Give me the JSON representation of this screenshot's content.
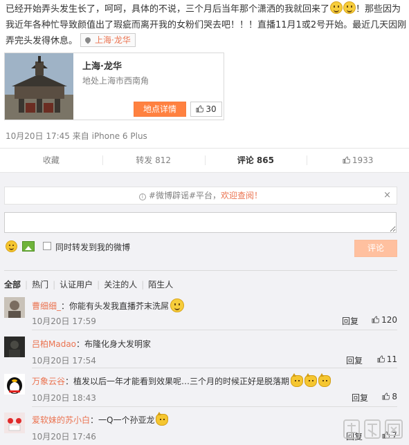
{
  "post": {
    "text_part1": "已经开始弄头发生长了，呵呵，具体的不说，三个月后当年那个潇洒的我就回来了",
    "text_part2": "！那些因为我近年各种忙导致颜值出了瑕疵而离开我的女粉们哭去吧！！！直播11月1或2号开始。最近几天因刚弄完头发得休息。",
    "location_chip": "上海·龙华"
  },
  "place_card": {
    "title": "上海·龙华",
    "subtitle": "地处上海市西南角",
    "detail_button": "地点详情",
    "like_count": "30"
  },
  "meta": {
    "date": "10月20日 17:45",
    "source_prefix": "来自",
    "device": "iPhone 6 Plus"
  },
  "actions": {
    "favorite": "收藏",
    "repost": "转发 812",
    "comment": "评论 865",
    "like": "1933"
  },
  "notice": {
    "prefix": "#微博辟谣#平台，",
    "link": "欢迎查阅！",
    "close": "×"
  },
  "composer": {
    "input_value": "",
    "repost_label": "同时转发到我的微博",
    "submit": "评论"
  },
  "filters": [
    "全部",
    "热门",
    "认证用户",
    "关注的人",
    "陌生人"
  ],
  "comments": [
    {
      "user": "曹细细_",
      "text": "：你能有头发我直播芥末洗屌",
      "time": "10月20日 17:59",
      "reply": "回复",
      "likes": "120"
    },
    {
      "user": "吕柏Madao",
      "text": "：布隆化身大发明家",
      "time": "10月20日 17:54",
      "reply": "回复",
      "likes": "11"
    },
    {
      "user": "万象云谷",
      "text": "：植发以后一年才能看到效果呢…三个月的时候正好是脱落期",
      "time": "10月20日 18:43",
      "reply": "回复",
      "likes": "8"
    },
    {
      "user": "爱软妹的苏小白",
      "text": "：一Q一个孙亚龙",
      "time": "10月20日 17:46",
      "reply": "回复",
      "likes": "7"
    }
  ],
  "colors": {
    "accent_orange": "#eb7350",
    "button_orange": "#ff8140",
    "comment_bg": "#f2f2f5"
  }
}
